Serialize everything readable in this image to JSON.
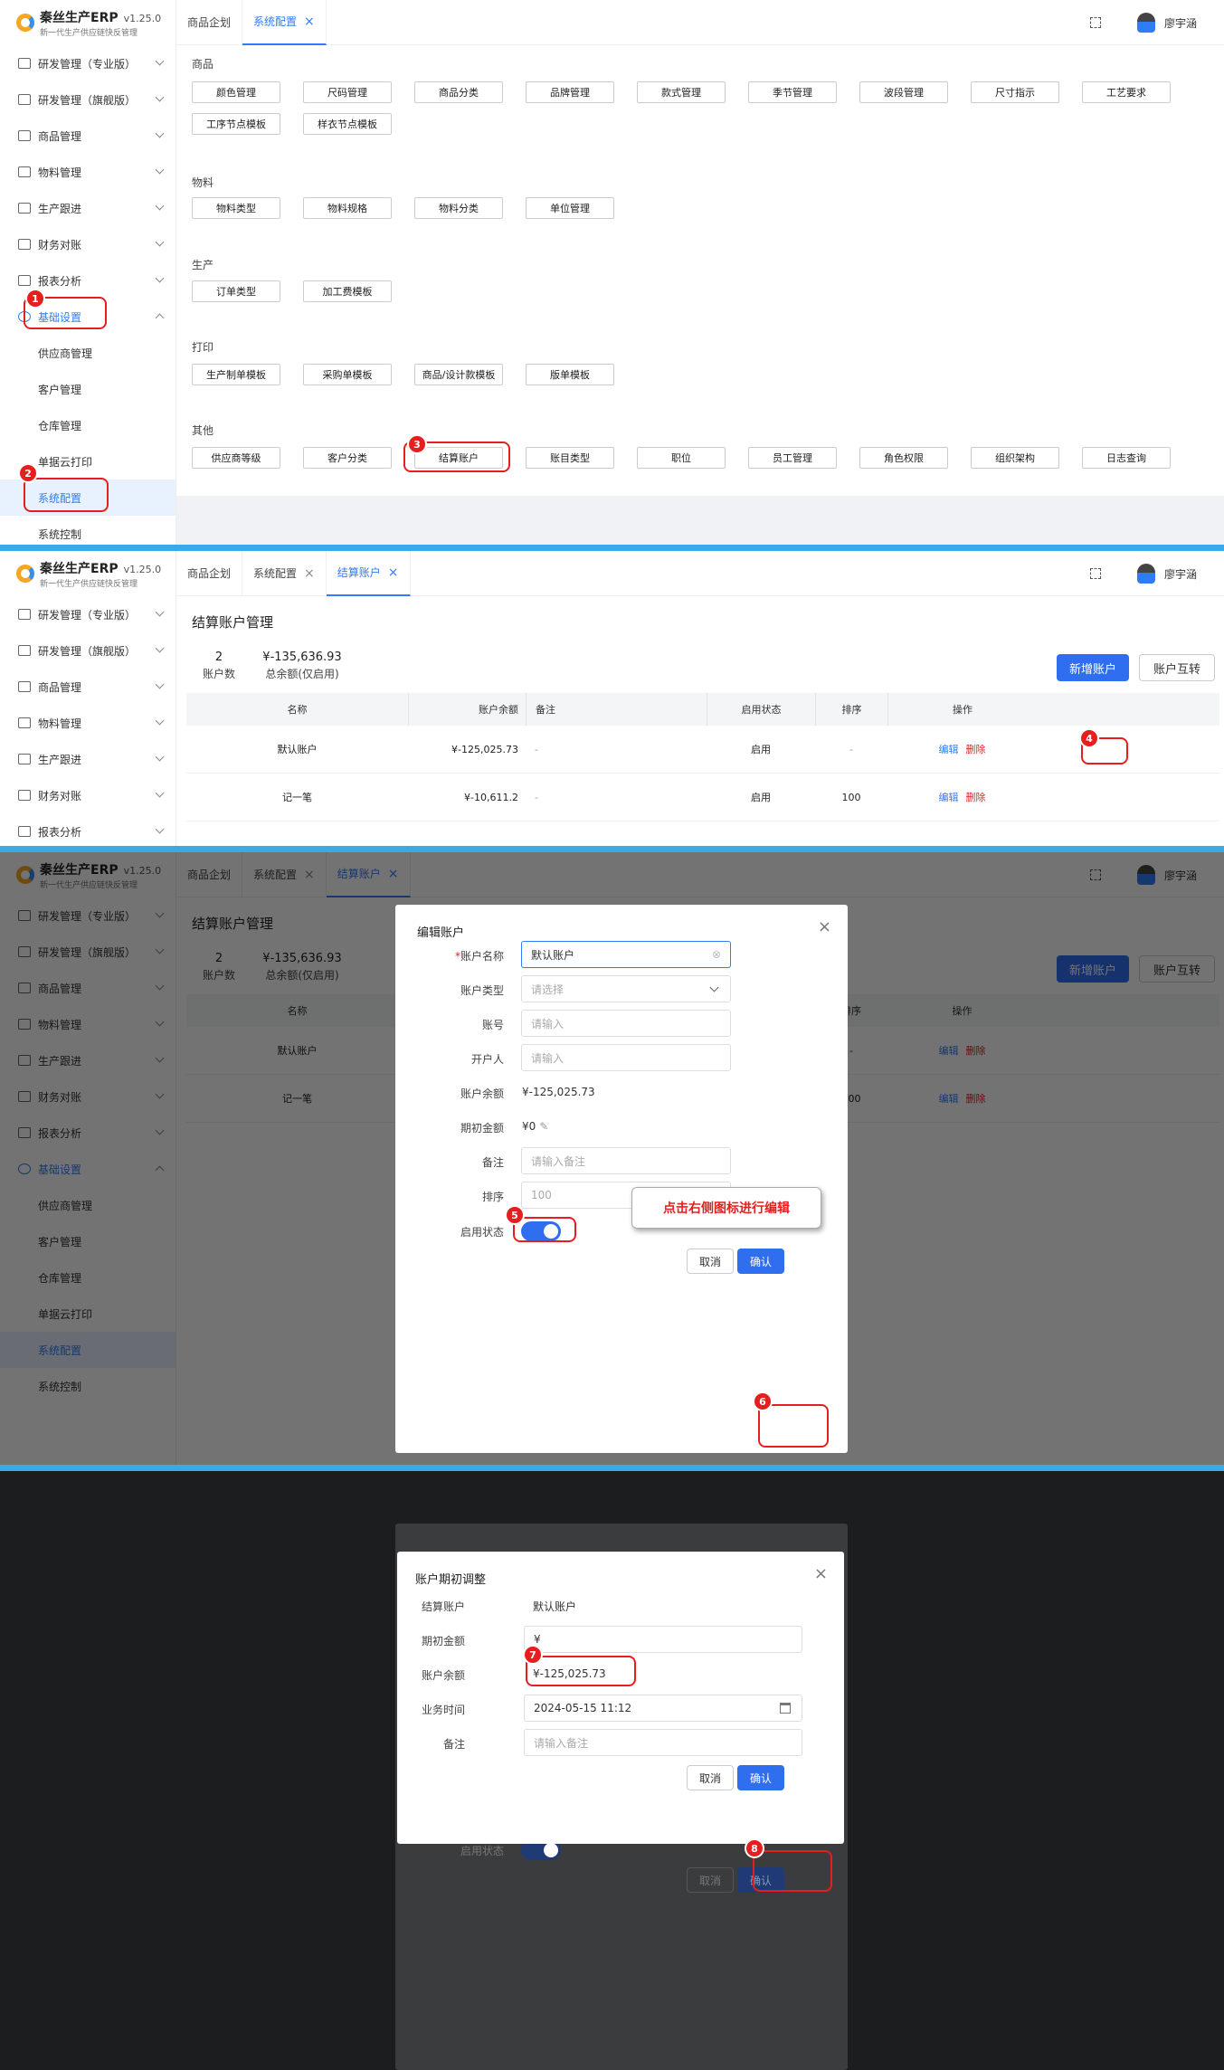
{
  "app": {
    "name": "秦丝生产ERP",
    "version": "v1.25.0",
    "slogan": "新一代生产供应链快反管理",
    "user": "廖宇涵"
  },
  "sidebar": {
    "items": [
      "研发管理（专业版）",
      "研发管理（旗舰版）",
      "商品管理",
      "物料管理",
      "生产跟进",
      "财务对账",
      "报表分析",
      "基础设置"
    ],
    "sub": [
      "供应商管理",
      "客户管理",
      "仓库管理",
      "单据云打印",
      "系统配置",
      "系统控制"
    ]
  },
  "tabs": {
    "t1": "商品企划",
    "t2": "系统配置",
    "t3": "结算账户"
  },
  "config": {
    "sections": {
      "goods": "商品",
      "material": "物料",
      "production": "生产",
      "print": "打印",
      "other": "其他"
    },
    "goods": [
      "颜色管理",
      "尺码管理",
      "商品分类",
      "品牌管理",
      "款式管理",
      "季节管理",
      "波段管理",
      "尺寸指示",
      "工艺要求",
      "工序节点模板",
      "样衣节点模板"
    ],
    "material": [
      "物料类型",
      "物料规格",
      "物料分类",
      "单位管理"
    ],
    "production": [
      "订单类型",
      "加工费模板"
    ],
    "print": [
      "生产制单模板",
      "采购单模板",
      "商品/设计款模板",
      "版单模板"
    ],
    "other": [
      "供应商等级",
      "客户分类",
      "结算账户",
      "账目类型",
      "职位",
      "员工管理",
      "角色权限",
      "组织架构",
      "日志查询"
    ]
  },
  "account_page": {
    "title": "结算账户管理",
    "count": "2",
    "count_label": "账户数",
    "total": "¥-135,636.93",
    "total_label": "总余额(仅启用)",
    "btn_add": "新增账户",
    "btn_transfer": "账户互转",
    "headers": [
      "名称",
      "账户余额",
      "备注",
      "启用状态",
      "排序",
      "操作"
    ],
    "rows": [
      {
        "name": "默认账户",
        "balance": "¥-125,025.73",
        "note": "-",
        "status": "启用",
        "order": "-"
      },
      {
        "name": "记一笔",
        "balance": "¥-10,611.2",
        "note": "-",
        "status": "启用",
        "order": "100"
      }
    ],
    "edit": "编辑",
    "delete": "删除"
  },
  "edit_modal": {
    "title": "编辑账户",
    "name_label": "账户名称",
    "name_value": "默认账户",
    "type_label": "账户类型",
    "type_ph": "请选择",
    "no_label": "账号",
    "no_ph": "请输入",
    "holder_label": "开户人",
    "holder_ph": "请输入",
    "balance_label": "账户余额",
    "balance_value": "¥-125,025.73",
    "init_label": "期初金额",
    "init_value": "¥0",
    "note_label": "备注",
    "note_ph": "请输入备注",
    "order_label": "排序",
    "order_ph": "100",
    "status_label": "启用状态",
    "cancel": "取消",
    "confirm": "确认",
    "callout": "点击右侧图标进行编辑"
  },
  "adjust_modal": {
    "title": "账户期初调整",
    "acc_label": "结算账户",
    "acc_value": "默认账户",
    "init_label": "期初金额",
    "init_value": "¥",
    "bal_label": "账户余额",
    "bal_value": "¥-125,025.73",
    "time_label": "业务时间",
    "time_value": "2024-05-15 11:12",
    "note_label": "备注",
    "note_ph": "请输入备注",
    "cancel": "取消",
    "confirm": "确认"
  },
  "bg_modal": {
    "order_label": "排序",
    "order_ph": "100",
    "status_label": "启用状态",
    "cancel": "取消",
    "confirm": "确认"
  },
  "steps": [
    "1",
    "2",
    "3",
    "4",
    "5",
    "6",
    "7",
    "8"
  ]
}
